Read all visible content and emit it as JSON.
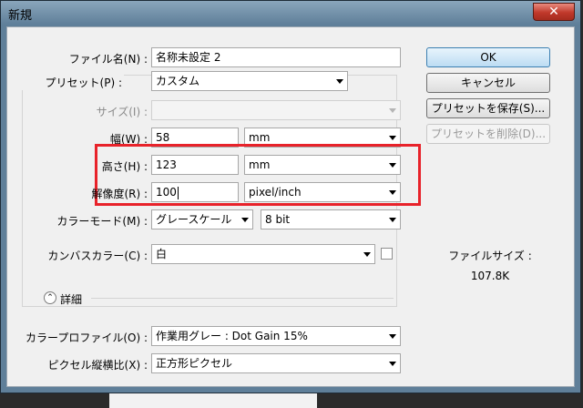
{
  "window": {
    "title": "新規",
    "close_glyph": "✕"
  },
  "form": {
    "name_label": "ファイル名(N) :",
    "name_value": "名称未設定 2",
    "preset_label": "プリセット(P) :",
    "preset_value": "カスタム",
    "size_label": "サイズ(I) :",
    "size_value": "",
    "width_label": "幅(W) :",
    "width_value": "58",
    "width_unit": "mm",
    "height_label": "高さ(H) :",
    "height_value": "123",
    "height_unit": "mm",
    "resolution_label": "解像度(R) :",
    "resolution_value": "100",
    "resolution_unit": "pixel/inch",
    "color_mode_label": "カラーモード(M) :",
    "color_mode_value": "グレースケール",
    "bit_depth_value": "8 bit",
    "canvas_color_label": "カンバスカラー(C) :",
    "canvas_color_value": "白",
    "advanced_label": "詳細",
    "profile_label": "カラープロファイル(O) :",
    "profile_value": "作業用グレー : Dot Gain 15%",
    "pixel_aspect_label": "ピクセル縦横比(X) :",
    "pixel_aspect_value": "正方形ピクセル"
  },
  "buttons": {
    "ok": "OK",
    "cancel": "キャンセル",
    "save_preset": "プリセットを保存(S)...",
    "delete_preset": "プリセットを削除(D)..."
  },
  "info": {
    "file_size_label": "ファイルサイズ :",
    "file_size_value": "107.8K"
  },
  "colors": {
    "highlight": "#e8222a",
    "titlebar": "#5f7f99",
    "ok_button": "#bcdcf3"
  },
  "icons": {
    "advanced_toggle": "chevron-up-double-icon",
    "dropdown": "triangle-down-icon",
    "close": "close-icon"
  }
}
